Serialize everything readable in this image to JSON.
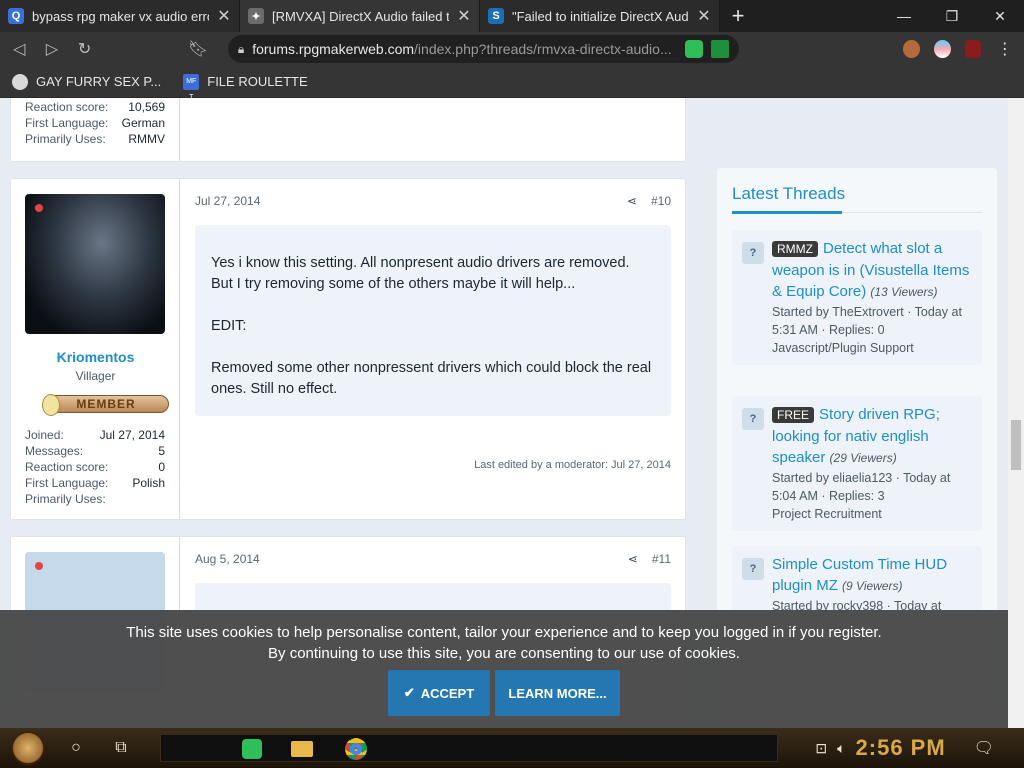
{
  "browser": {
    "tabs": [
      {
        "title": "bypass rpg maker vx audio error",
        "fav": "Q",
        "fav_color": "#3d6fd8"
      },
      {
        "title": "[RMVXA] DirectX Audio failed t",
        "fav": "✦",
        "fav_color": "#6b6b6b"
      },
      {
        "title": "\"Failed to initialize DirectX Aud",
        "fav": "S",
        "fav_color": "#1b6fb5"
      }
    ],
    "url_host": "forums.rpgmakerweb.com",
    "url_path": "/index.php?threads/rmvxa-directx-audio...",
    "bookmarks": [
      "GAY FURRY SEX P...",
      "FILE ROULETTE"
    ],
    "bookmark_icon_text": "MF T"
  },
  "prev_post": {
    "stats": [
      {
        "label": "Reaction score:",
        "value": "10,569"
      },
      {
        "label": "First Language:",
        "value": "German"
      },
      {
        "label": "Primarily Uses:",
        "value": "RMMV"
      }
    ]
  },
  "post10": {
    "username": "Kriomentos",
    "user_title": "Villager",
    "badge": "MEMBER",
    "stats": [
      {
        "label": "Joined:",
        "value": "Jul 27, 2014"
      },
      {
        "label": "Messages:",
        "value": "5"
      },
      {
        "label": "Reaction score:",
        "value": "0"
      },
      {
        "label": "First Language:",
        "value": "Polish"
      },
      {
        "label": "Primarily Uses:",
        "value": ""
      }
    ],
    "date": "Jul 27, 2014",
    "number": "#10",
    "paragraphs": [
      "Yes i know this setting. All nonpresent audio drivers are removed. But I try removing some of the others maybe it will help...",
      "EDIT:",
      "Removed some other nonpressent drivers which could block the real ones. Still no effect."
    ],
    "last_edited": "Last edited by a moderator: Jul 27, 2014"
  },
  "post11": {
    "date": "Aug 5, 2014",
    "number": "#11"
  },
  "sidebar": {
    "title": "Latest Threads",
    "threads": [
      {
        "tag": "RMMZ",
        "title": "Detect what slot a weapon is in (Visustella Items & Equip Core)",
        "views": "(13 Viewers)",
        "meta": "Started by TheExtrovert · Today at 5:31 AM · Replies: 0",
        "forum": "Javascript/Plugin Support"
      },
      {
        "tag": "FREE",
        "title": "Story driven RPG; looking for nativ english speaker",
        "views": "(29 Viewers)",
        "meta": "Started by eliaelia123 · Today at 5:04 AM · Replies: 3",
        "forum": "Project Recruitment"
      },
      {
        "tag": "",
        "title": "Simple Custom Time HUD plugin MZ",
        "views": "(9 Viewers)",
        "meta": "Started by rocky398 · Today at",
        "forum": ""
      }
    ]
  },
  "cookie": {
    "line1": "This site uses cookies to help personalise content, tailor your experience and to keep you logged in if you register.",
    "line2": "By continuing to use this site, you are consenting to our use of cookies.",
    "accept": "ACCEPT",
    "learn": "LEARN MORE..."
  },
  "taskbar": {
    "clock": "2:56 PM"
  }
}
